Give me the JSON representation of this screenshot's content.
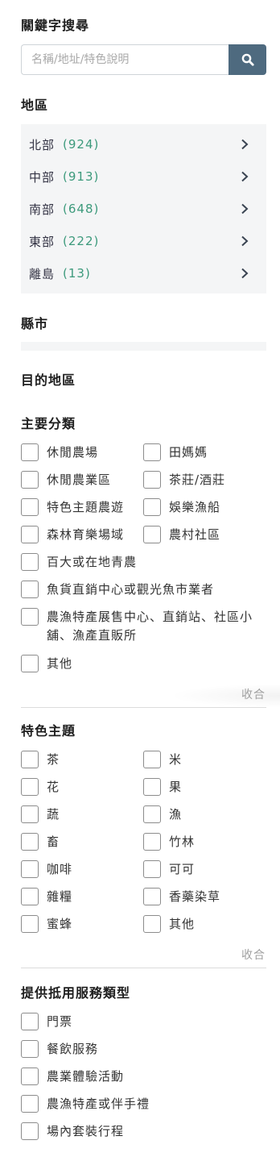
{
  "search": {
    "title": "關鍵字搜尋",
    "placeholder": "名稱/地址/特色說明"
  },
  "region": {
    "title": "地區",
    "items": [
      {
        "name": "北部",
        "count": "(924)"
      },
      {
        "name": "中部",
        "count": "(913)"
      },
      {
        "name": "南部",
        "count": "(648)"
      },
      {
        "name": "東部",
        "count": "(222)"
      },
      {
        "name": "離島",
        "count": "(13)"
      }
    ]
  },
  "county": {
    "title": "縣市"
  },
  "destination": {
    "title": "目的地區"
  },
  "main_category": {
    "title": "主要分類",
    "items": [
      "休閒農場",
      "田媽媽",
      "休閒農業區",
      "茶莊/酒莊",
      "特色主題農遊",
      "娛樂漁船",
      "森林育樂場域",
      "農村社區",
      "百大或在地青農",
      "魚貨直銷中心或觀光魚市業者",
      "農漁特產展售中心、直銷站、社區小舖、漁產直販所",
      "其他"
    ],
    "collapse": "收合"
  },
  "theme": {
    "title": "特色主題",
    "items": [
      "茶",
      "米",
      "花",
      "果",
      "蔬",
      "漁",
      "畜",
      "竹林",
      "咖啡",
      "可可",
      "雜糧",
      "香藥染草",
      "蜜蜂",
      "其他"
    ],
    "collapse": "收合"
  },
  "service": {
    "title": "提供抵用服務類型",
    "items": [
      "門票",
      "餐飲服務",
      "農業體驗活動",
      "農漁特產或伴手禮",
      "場內套裝行程"
    ]
  },
  "colors": {
    "accent": "#4e6a7f",
    "count_green": "#3d9a7c",
    "panel_bg": "#f4f5f6"
  }
}
